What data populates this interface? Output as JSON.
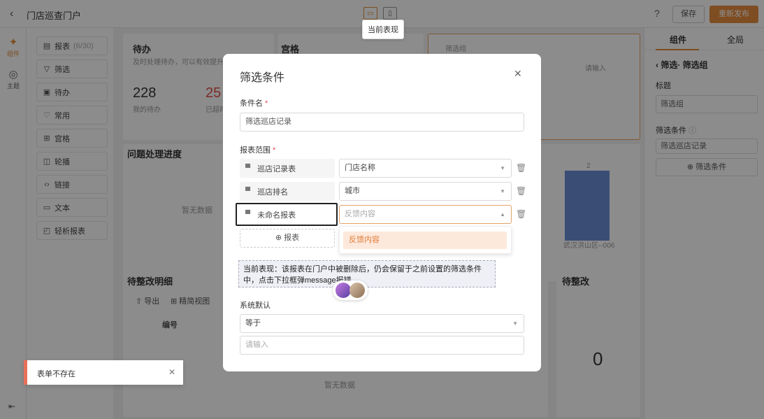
{
  "header": {
    "back_glyph": "‹",
    "title": "门店巡查门户",
    "tooltip": "当前表现",
    "help_glyph": "?",
    "save_label": "保存",
    "publish_label": "重新发布"
  },
  "rail": {
    "items": [
      {
        "icon": "puzzle-icon",
        "label": "组件"
      },
      {
        "icon": "palette-icon",
        "label": "主题"
      }
    ]
  },
  "components": {
    "items": [
      {
        "icon": "report-icon",
        "label": "报表",
        "count": "(6/30)"
      },
      {
        "icon": "filter-icon",
        "label": "筛选"
      },
      {
        "icon": "todo-icon",
        "label": "待办"
      },
      {
        "icon": "heart-icon",
        "label": "常用"
      },
      {
        "icon": "grid-icon",
        "label": "宫格"
      },
      {
        "icon": "carousel-icon",
        "label": "轮播"
      },
      {
        "icon": "link-icon",
        "label": "链接"
      },
      {
        "icon": "text-icon",
        "label": "文本"
      },
      {
        "icon": "light-report-icon",
        "label": "轻析报表"
      }
    ]
  },
  "canvas": {
    "todo": {
      "title": "待办",
      "subtitle": "及时处理待办，可以有效提升效率",
      "my_todo_value": "228",
      "my_todo_label": "我的待办",
      "overdue_value": "25",
      "overdue_label": "已超时"
    },
    "grid_title": "宫格",
    "filter_card_title": "筛选组",
    "filter_input_placeholder": "请输入",
    "progress_title": "问题处理进度",
    "empty_text": "暂无数据",
    "bar_label": "武汉洪山区--006",
    "bar_value": "2",
    "detail_title": "待整改明细",
    "export_label": "导出",
    "simple_view_label": "精简视图",
    "col_number": "编号",
    "pending_title": "待整改",
    "pending_value": "0"
  },
  "right_panel": {
    "tab_component": "组件",
    "tab_global": "全局",
    "crumb": "筛选· 筛选组",
    "title_label": "标题",
    "title_value": "筛选组",
    "cond_label": "筛选条件",
    "cond_value": "筛选巡店记录",
    "add_cond_label": "筛选条件"
  },
  "modal": {
    "title": "筛选条件",
    "name_label": "条件名",
    "name_value": "筛选巡店记录",
    "scope_label": "报表范围",
    "rows": [
      {
        "report": "巡店记录表",
        "field": "门店名称"
      },
      {
        "report": "巡店排名",
        "field": "城市"
      },
      {
        "report": "未命名报表",
        "field": "反馈内容"
      }
    ],
    "add_report_label": "报表",
    "dropdown_option": "反馈内容",
    "annotation": "当前表现：该报表在门户中被删除后，仍会保留于之前设置的筛选条件中，点击下拉框弹message报错",
    "default_label": "系统默认",
    "operator_value": "等于",
    "value_placeholder": "请输入"
  },
  "toast": {
    "message": "表单不存在"
  }
}
